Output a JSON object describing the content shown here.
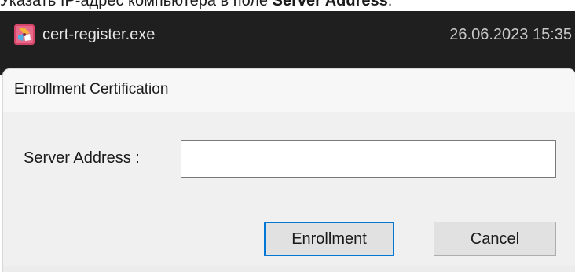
{
  "document": {
    "caption_prefix": "Указать IP-адрес компьютера в поле ",
    "caption_bold": "Server Address",
    "caption_suffix": "."
  },
  "file_strip": {
    "file_name": "cert-register.exe",
    "timestamp": "26.06.2023 15:35",
    "icon": "app-icon"
  },
  "dialog": {
    "title": "Enrollment Certification",
    "server_label": "Server Address :",
    "server_value": "",
    "server_placeholder": "",
    "enroll_label": "Enrollment",
    "cancel_label": "Cancel"
  },
  "colors": {
    "strip_bg": "#1f1f1f",
    "dialog_bg": "#f0f0f0",
    "focus_border": "#0078d7"
  }
}
